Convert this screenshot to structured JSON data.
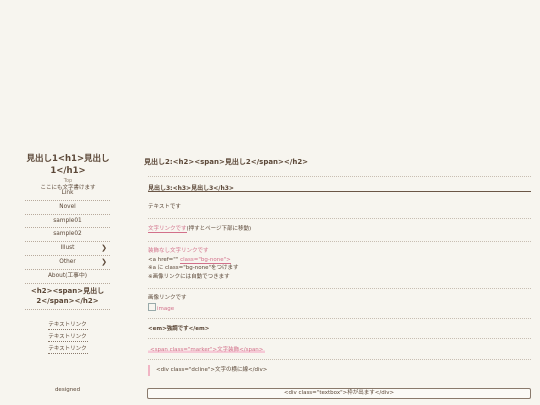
{
  "sidebar": {
    "title": "見出し1<h1>見出し1</h1>",
    "top_label": "Top",
    "subtitle": "ここにも文字書けます",
    "nav": [
      {
        "label": "Link",
        "arrow": false
      },
      {
        "label": "Novel",
        "arrow": false
      },
      {
        "label": "sample01",
        "arrow": false
      },
      {
        "label": "sample02",
        "arrow": false
      },
      {
        "label": "Illust",
        "arrow": true
      },
      {
        "label": "Other",
        "arrow": true
      },
      {
        "label": "About(工事中)",
        "arrow": false
      }
    ],
    "h2": "<h2><span>見出し2</span></h2>",
    "links": [
      "テキストリンク",
      "テキストリンク",
      "テキストリンク"
    ],
    "designed": "designed"
  },
  "main": {
    "h2": "見出し2:<h2><span>見出し2</span></h2>",
    "h3": "見出し3:<h3>見出し3</h3>",
    "text": "テキストです",
    "link_text": "文字リンクです",
    "link_note": "(押すとページ下部に移動)",
    "nounderline_link": "装飾なし文字リンクです",
    "code_a": "<a href=\"\" ",
    "code_class": "class=\"bg-none\">",
    "note1": "※a に class=\"bg-none\"をつけます",
    "note2": "※画像リンクには自動でつきます",
    "image_link_text": "画像リンクです",
    "image_alt": "image",
    "em": "<em>強調です</em>",
    "marker": "<span class=\"marker\">文字装飾</span>",
    "dcline": "<div class=\"dcline\">文字の横に線</div>",
    "textbox": "<div class=\"textbox\">枠が出ます</div>"
  },
  "colors": {
    "accent": "#d2708a",
    "text": "#5a4636",
    "background": "#f7f5ef"
  },
  "icons": {
    "nav_arrow": "chevron-right-icon"
  }
}
